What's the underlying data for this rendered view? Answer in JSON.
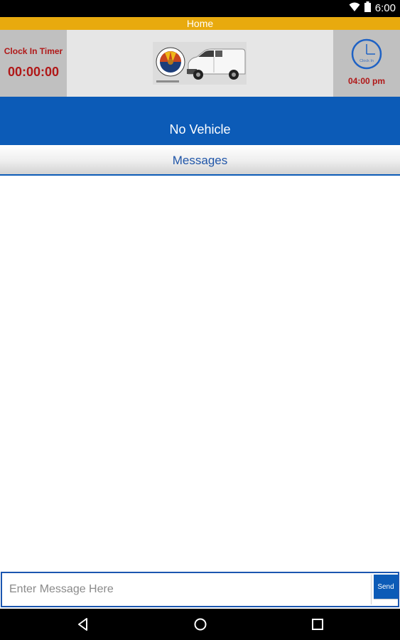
{
  "status_bar": {
    "time": "6:00",
    "icons": [
      "wifi-icon",
      "battery-icon"
    ]
  },
  "header": {
    "title": "Home"
  },
  "timer": {
    "label": "Clock In Timer",
    "value": "00:00:00"
  },
  "logo": {
    "icons": [
      "arizona-seal-icon",
      "cargo-van-image"
    ]
  },
  "clock": {
    "button_caption": "Clock In",
    "time": "04:00 pm"
  },
  "vehicle": {
    "label": "No Vehicle"
  },
  "messages": {
    "title": "Messages",
    "items": []
  },
  "compose": {
    "placeholder": "Enter Message Here",
    "value": "",
    "send_label": "Send"
  },
  "nav": {
    "icons": [
      "back-icon",
      "home-icon",
      "recents-icon"
    ]
  },
  "colors": {
    "header_strip": "#e8aa0e",
    "primary_blue": "#0c5bb7",
    "timer_red": "#b01818",
    "panel_gray": "#c0c0c0"
  }
}
